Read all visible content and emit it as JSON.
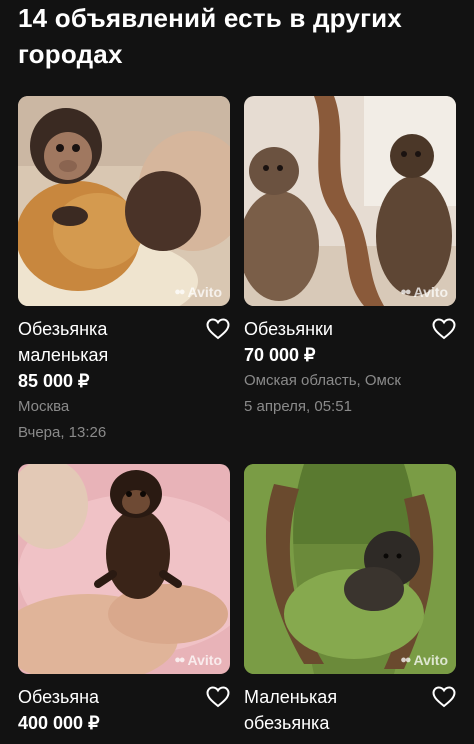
{
  "heading": "14 объявлений есть в других городах",
  "watermark": "Avito",
  "listings": [
    {
      "title": "Обезьянка маленькая",
      "price": "85 000 ₽",
      "location": "Москва",
      "date": "Вчера, 13:26",
      "favorite_icon": "heart-outline-icon"
    },
    {
      "title": "Обезьянки",
      "price": "70 000 ₽",
      "location": "Омская область, Омск",
      "date": "5 апреля, 05:51",
      "favorite_icon": "heart-outline-icon"
    },
    {
      "title": "Обезьяна",
      "price": "400 000 ₽",
      "location": "",
      "date": "",
      "favorite_icon": "heart-outline-icon"
    },
    {
      "title": "Маленькая обезьянка",
      "price": "",
      "location": "",
      "date": "",
      "favorite_icon": "heart-outline-icon"
    }
  ]
}
